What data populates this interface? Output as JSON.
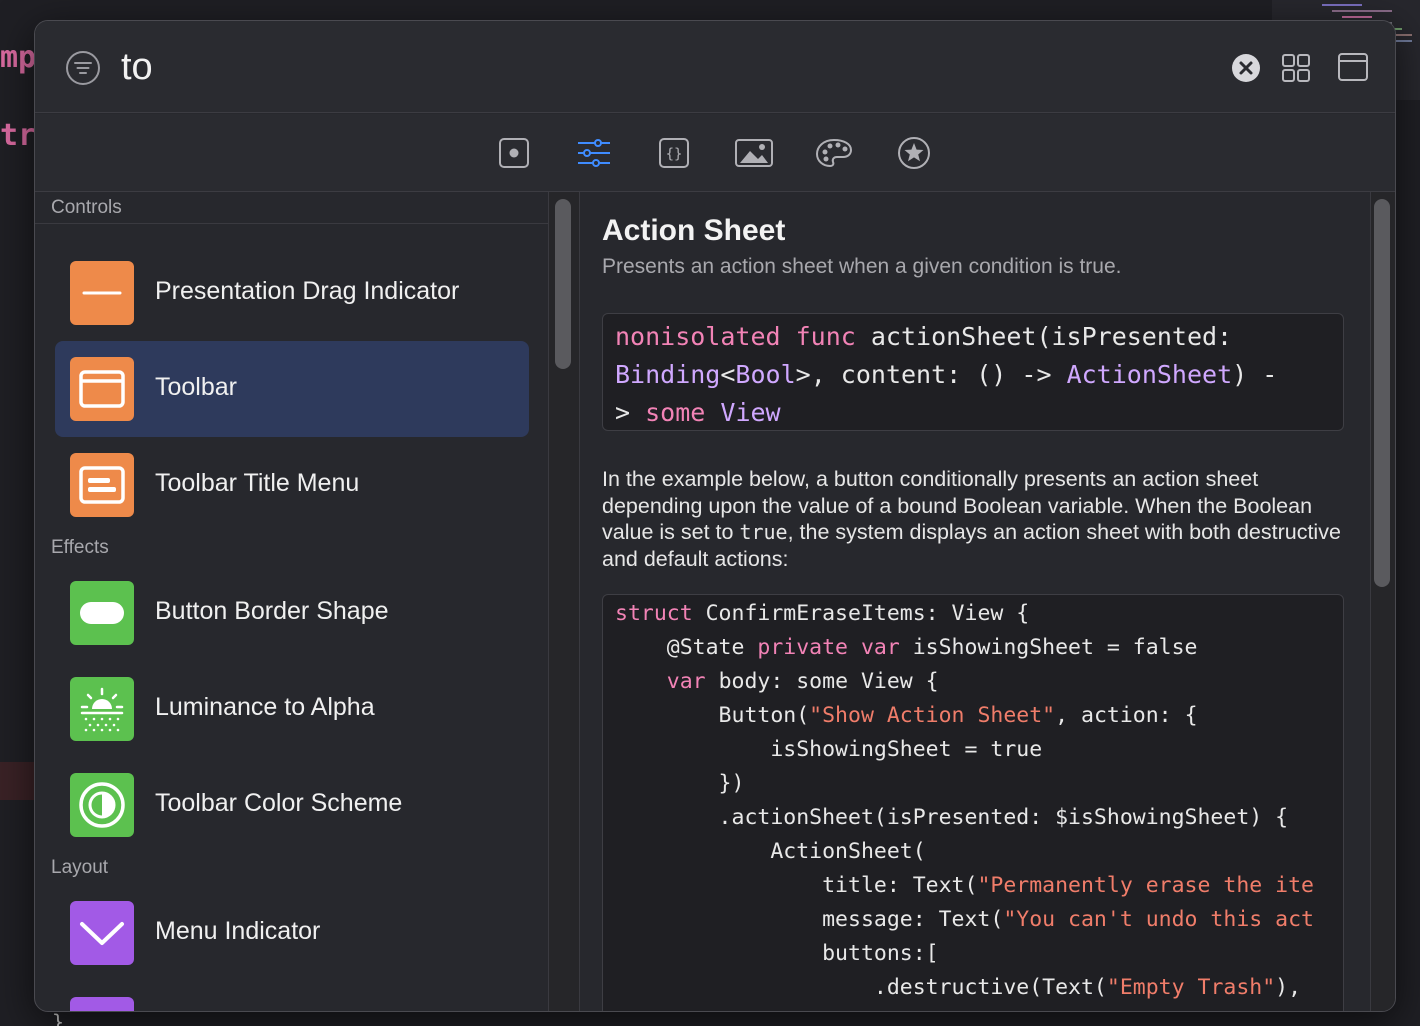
{
  "background": {
    "code_top": "mp",
    "code_mid": "tr",
    "brace": "}"
  },
  "search": {
    "value": "to"
  },
  "tabs": [
    {
      "icon": "views-icon",
      "selected": false
    },
    {
      "icon": "modifiers-icon",
      "selected": true
    },
    {
      "icon": "snippets-icon",
      "selected": false
    },
    {
      "icon": "image-icon",
      "selected": false
    },
    {
      "icon": "color-palette-icon",
      "selected": false
    },
    {
      "icon": "star-icon",
      "selected": false
    }
  ],
  "sections": {
    "controls": "Controls",
    "effects": "Effects",
    "layout": "Layout"
  },
  "items": [
    {
      "label": "Presentation Drag Indicator",
      "icon": "drag-indicator-icon",
      "color": "#ee8a4a"
    },
    {
      "label": "Toolbar",
      "icon": "toolbar-icon",
      "color": "#ee8a4a",
      "selected": true
    },
    {
      "label": "Toolbar Title Menu",
      "icon": "toolbar-title-menu-icon",
      "color": "#ee8a4a"
    },
    {
      "label": "Button Border Shape",
      "icon": "capsule-icon",
      "color": "#5cc14f"
    },
    {
      "label": "Luminance to Alpha",
      "icon": "sun-haze-icon",
      "color": "#5cc14f"
    },
    {
      "label": "Toolbar Color Scheme",
      "icon": "color-scheme-icon",
      "color": "#5cc14f"
    },
    {
      "label": "Menu Indicator",
      "icon": "chevron-down-icon",
      "color": "#a25ae6"
    }
  ],
  "detail": {
    "title": "Action Sheet",
    "subtitle": "Presents an action sheet when a given condition is true.",
    "declaration": {
      "l1_kw": "nonisolated func",
      "l1_rest": " actionSheet(isPresented:",
      "l2_ty1": "Binding",
      "l2_a": "<",
      "l2_ty2": "Bool",
      "l2_b": ">, content: () ->",
      "l2_ty3": "ActionSheet",
      "l2_c": ") -",
      "l3_a": ">",
      "l3_kw": "some",
      "l3_ty": "View"
    },
    "description_a": "In the example below, a button conditionally presents an action sheet depending upon the value of a bound Boolean variable. When the Boolean value is set to ",
    "description_code": "true",
    "description_b": ", the system displays an action sheet with both destructive and default actions:",
    "example": {
      "l1_kw": "struct",
      "l1_rest": " ConfirmEraseItems: View {",
      "l2_a": "    @State ",
      "l2_kw": "private var",
      "l2_b": " isShowingSheet = false",
      "l3_a": "    ",
      "l3_kw": "var",
      "l3_b": " body: some View {",
      "l4_a": "        Button(",
      "l4_str": "\"Show Action Sheet\"",
      "l4_b": ", action: {",
      "l5": "            isShowingSheet = true",
      "l6": "        })",
      "l7": "        .actionSheet(isPresented: $isShowingSheet) {",
      "l8": "            ActionSheet(",
      "l9_a": "                title: Text(",
      "l9_str": "\"Permanently erase the ite",
      "l10_a": "                message: Text(",
      "l10_str": "\"You can't undo this act",
      "l11": "                buttons:[",
      "l12_a": "                    .destructive(Text(",
      "l12_str": "\"Empty Trash\"",
      "l12_b": "),"
    }
  }
}
